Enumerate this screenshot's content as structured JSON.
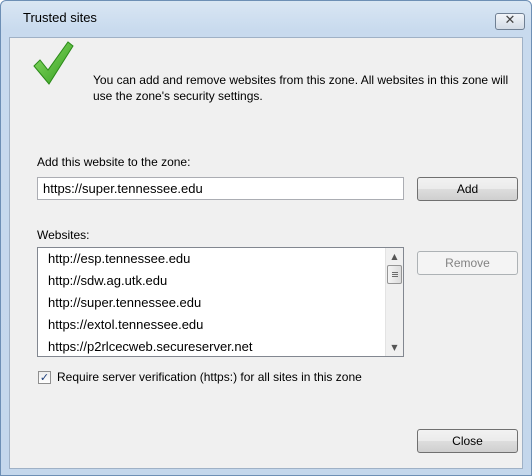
{
  "window": {
    "title": "Trusted sites",
    "close_glyph": "✕"
  },
  "intro": {
    "icon": "green-checkmark-icon",
    "text": "You can add and remove websites from this zone. All websites in this zone will use the zone's security settings."
  },
  "add_section": {
    "label": "Add this website to the zone:",
    "input_value": "https://super.tennessee.edu",
    "add_button": "Add"
  },
  "websites_section": {
    "label": "Websites:",
    "items": [
      "http://esp.tennessee.edu",
      "http://sdw.ag.utk.edu",
      "http://super.tennessee.edu",
      "https://extol.tennessee.edu",
      "https://p2rlcecweb.secureserver.net"
    ],
    "remove_button": "Remove",
    "remove_enabled": false
  },
  "verification": {
    "checked": true,
    "label": "Require server verification (https:) for all sites in this zone"
  },
  "footer": {
    "close_button": "Close"
  },
  "colors": {
    "frame": "#c4d7ec",
    "check_green": "#3fae29"
  }
}
